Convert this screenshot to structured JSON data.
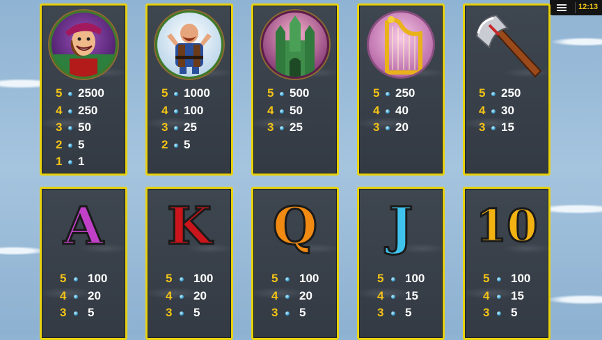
{
  "top_bar": {
    "menu_icon": "hamburger-menu-icon",
    "clock": "12:13"
  },
  "symbols": [
    {
      "name": "Jack",
      "icon": "jack-hero-icon",
      "pays": [
        {
          "count": "5",
          "amount": "2500"
        },
        {
          "count": "4",
          "amount": "250"
        },
        {
          "count": "3",
          "amount": "50"
        },
        {
          "count": "2",
          "amount": "5"
        },
        {
          "count": "1",
          "amount": "1"
        }
      ]
    },
    {
      "name": "Giant",
      "icon": "giant-icon",
      "pays": [
        {
          "count": "5",
          "amount": "1000"
        },
        {
          "count": "4",
          "amount": "100"
        },
        {
          "count": "3",
          "amount": "25"
        },
        {
          "count": "2",
          "amount": "5"
        }
      ]
    },
    {
      "name": "Castle",
      "icon": "castle-icon",
      "pays": [
        {
          "count": "5",
          "amount": "500"
        },
        {
          "count": "4",
          "amount": "50"
        },
        {
          "count": "3",
          "amount": "25"
        }
      ]
    },
    {
      "name": "Harp",
      "icon": "golden-harp-icon",
      "pays": [
        {
          "count": "5",
          "amount": "250"
        },
        {
          "count": "4",
          "amount": "40"
        },
        {
          "count": "3",
          "amount": "20"
        }
      ]
    },
    {
      "name": "Axe",
      "icon": "axe-icon",
      "pays": [
        {
          "count": "5",
          "amount": "250"
        },
        {
          "count": "4",
          "amount": "30"
        },
        {
          "count": "3",
          "amount": "15"
        }
      ]
    },
    {
      "name": "A",
      "letter": "A",
      "color": "#c040c8",
      "pays": [
        {
          "count": "5",
          "amount": "100"
        },
        {
          "count": "4",
          "amount": "20"
        },
        {
          "count": "3",
          "amount": "5"
        }
      ]
    },
    {
      "name": "K",
      "letter": "K",
      "color": "#c9151b",
      "pays": [
        {
          "count": "5",
          "amount": "100"
        },
        {
          "count": "4",
          "amount": "20"
        },
        {
          "count": "3",
          "amount": "5"
        }
      ]
    },
    {
      "name": "Q",
      "letter": "Q",
      "color": "#f08a12",
      "pays": [
        {
          "count": "5",
          "amount": "100"
        },
        {
          "count": "4",
          "amount": "20"
        },
        {
          "count": "3",
          "amount": "5"
        }
      ]
    },
    {
      "name": "J",
      "letter": "J",
      "color": "#3fc3ec",
      "pays": [
        {
          "count": "5",
          "amount": "100"
        },
        {
          "count": "4",
          "amount": "15"
        },
        {
          "count": "3",
          "amount": "5"
        }
      ]
    },
    {
      "name": "10",
      "letter": "10",
      "color": "#f2b312",
      "pays": [
        {
          "count": "5",
          "amount": "100"
        },
        {
          "count": "4",
          "amount": "15"
        },
        {
          "count": "3",
          "amount": "5"
        }
      ]
    }
  ]
}
